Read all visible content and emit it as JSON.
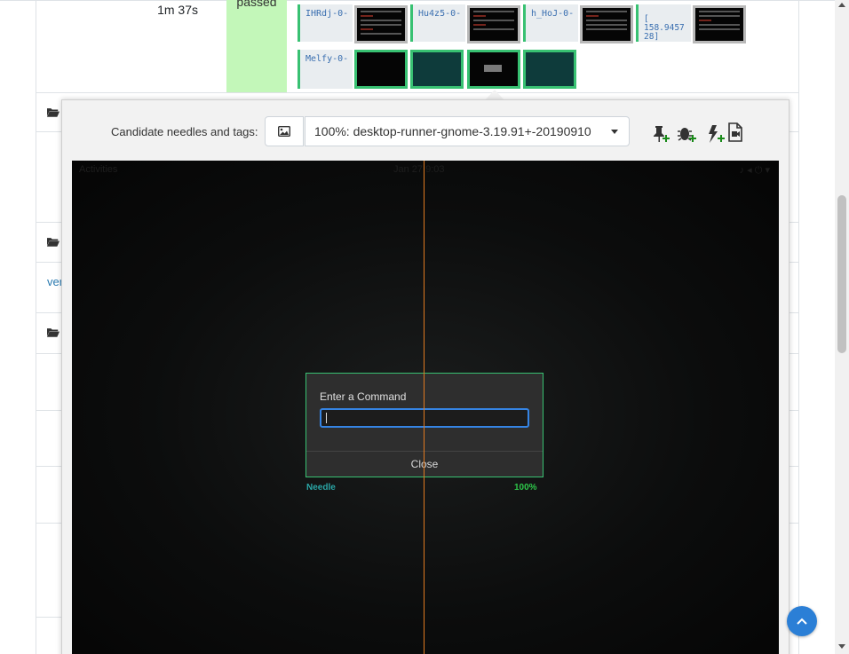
{
  "result_row": {
    "duration": "1m 37s",
    "result": "passed"
  },
  "steps": [
    {
      "label": "IHRdj-0-",
      "thumbs": 1
    },
    {
      "label": "Hu4z5-0-",
      "thumbs": 1
    },
    {
      "label": "h_HoJ-0-",
      "thumbs": 1
    },
    {
      "label": "[\n158.9457\n28]",
      "thumbs": 1
    },
    {
      "label": "Melfy-0-",
      "thumbs": 4
    }
  ],
  "partial_link": "ver",
  "candidate": {
    "label": "Candidate needles and tags:",
    "selected": "100%: desktop-runner-gnome-3.19.91+-20190910",
    "tools": [
      "create-new-needle-icon",
      "report-bug-icon",
      "mark-fail-icon",
      "show-source-icon"
    ]
  },
  "screenshot": {
    "topbar_left": "Activities",
    "topbar_center": "Jan 27  9:03",
    "dialog_title": "Enter a Command",
    "dialog_close": "Close",
    "needle_label": "Needle",
    "match_percent": "100%"
  },
  "colors": {
    "pass": "#c3f7b9",
    "match": "#38c172",
    "divider": "#e07a20",
    "accent": "#2b7fd6"
  }
}
